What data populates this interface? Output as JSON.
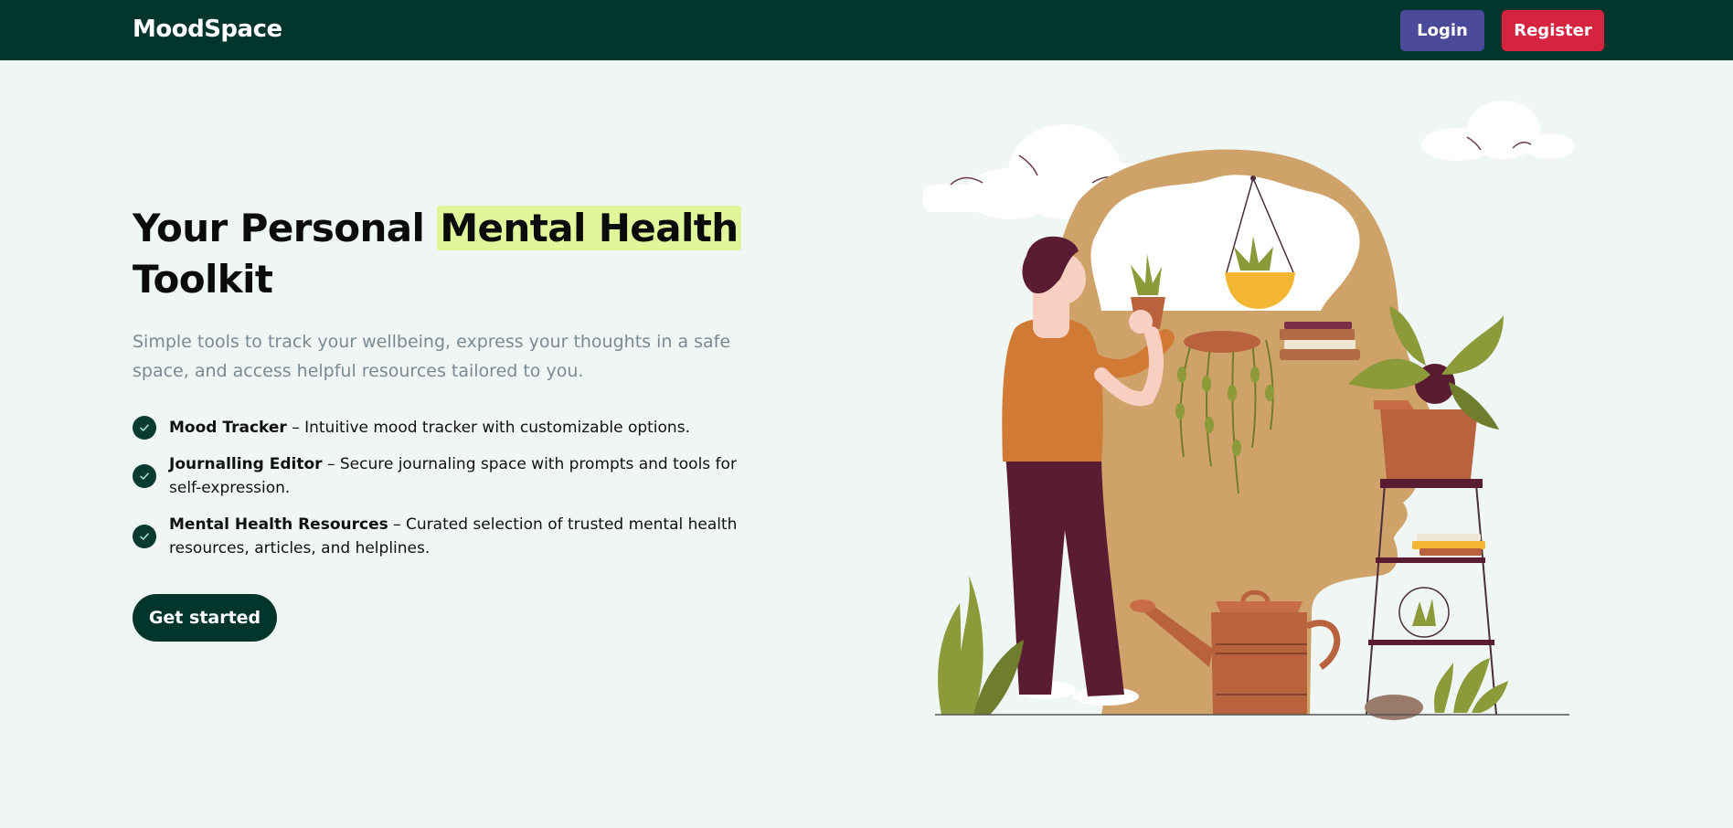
{
  "nav": {
    "brand": "MoodSpace",
    "login_label": "Login",
    "register_label": "Register"
  },
  "hero": {
    "title_prefix": "Your Personal ",
    "title_highlight": "Mental Health",
    "title_suffix": "Toolkit",
    "subtitle": "Simple tools to track your wellbeing, express your thoughts in a safe space, and access helpful resources tailored to you.",
    "features": [
      {
        "name": "Mood Tracker",
        "description": " – Intuitive mood tracker with customizable options."
      },
      {
        "name": "Journalling Editor",
        "description": " – Secure journaling space with prompts and tools for self-expression."
      },
      {
        "name": "Mental Health Resources",
        "description": " – Curated selection of trusted mental health resources, articles, and helplines."
      }
    ],
    "cta_label": "Get started"
  },
  "colors": {
    "nav_bg": "#02352c",
    "login": "#4b4a9a",
    "register": "#d6233f",
    "highlight": "#e1f59a",
    "page_bg": "#eff6f4"
  },
  "icons": {
    "feature_marker": "check-circle-icon",
    "illustration": "person-with-plants-in-head-illustration"
  }
}
